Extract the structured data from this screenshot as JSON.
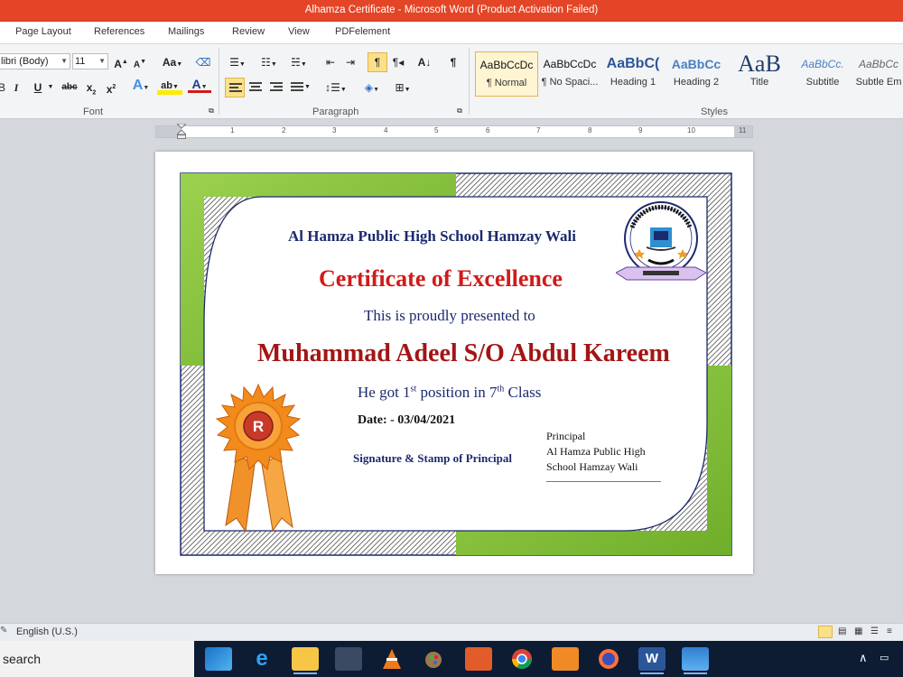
{
  "window": {
    "title": "Alhamza Certificate - Microsoft Word (Product Activation Failed)"
  },
  "ribbon": {
    "tabs": [
      "Page Layout",
      "References",
      "Mailings",
      "Review",
      "View",
      "PDFelement"
    ],
    "font": {
      "name": "libri (Body)",
      "size": "11",
      "group_label": "Font"
    },
    "paragraph": {
      "group_label": "Paragraph"
    },
    "styles": {
      "group_label": "Styles",
      "items": [
        {
          "preview": "AaBbCcDc",
          "name": "¶ Normal"
        },
        {
          "preview": "AaBbCcDc",
          "name": "¶ No Spaci..."
        },
        {
          "preview": "AaBbC(",
          "name": "Heading 1"
        },
        {
          "preview": "AaBbCc",
          "name": "Heading 2"
        },
        {
          "preview": "AaB",
          "name": "Title"
        },
        {
          "preview": "AaBbCc.",
          "name": "Subtitle"
        },
        {
          "preview": "AaBbCc",
          "name": "Subtle Em"
        }
      ]
    }
  },
  "ruler": {
    "numbers": [
      "1",
      "2",
      "3",
      "4",
      "5",
      "6",
      "7",
      "8",
      "9",
      "10",
      "11"
    ]
  },
  "certificate": {
    "school": "Al Hamza Public High School Hamzay Wali",
    "title": "Certificate of Excellence",
    "presented": "This is proudly presented to",
    "recipient": "Muhammad Adeel S/O Abdul Kareem",
    "position_pre": "He got 1",
    "position_sup1": "st",
    "position_mid": " position in 7",
    "position_sup2": "th",
    "position_post": " Class",
    "date": "Date: - 03/04/2021",
    "signature_label": "Signature & Stamp of Principal",
    "principal_lines": [
      "Principal",
      "Al Hamza Public High",
      "School Hamzay Wali"
    ],
    "colors": {
      "green": "#8cc63f",
      "navy": "#1c2a6e",
      "red": "#d11a1a"
    }
  },
  "status": {
    "language": "English (U.S.)"
  },
  "taskbar": {
    "search_placeholder": "search"
  }
}
